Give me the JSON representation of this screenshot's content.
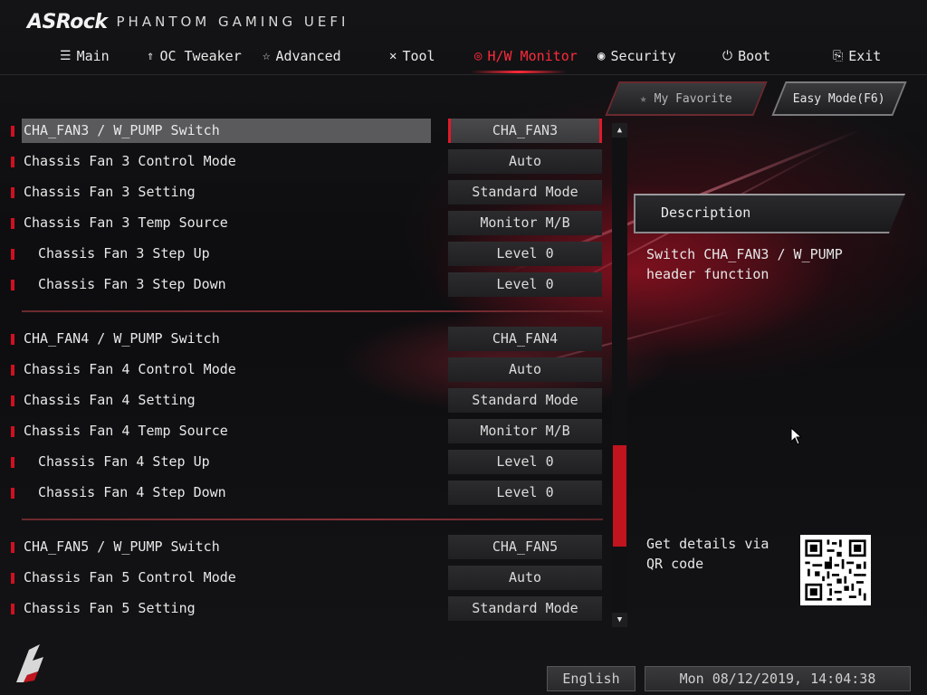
{
  "brand": {
    "logo": "ASRock",
    "subtitle": "PHANTOM GAMING UEFI"
  },
  "nav": [
    {
      "label": "Main",
      "icon": "list-icon"
    },
    {
      "label": "OC Tweaker",
      "icon": "rocket-icon"
    },
    {
      "label": "Advanced",
      "icon": "star-icon"
    },
    {
      "label": "Tool",
      "icon": "tools-icon"
    },
    {
      "label": "H/W Monitor",
      "icon": "monitor-icon",
      "active": true
    },
    {
      "label": "Security",
      "icon": "shield-icon"
    },
    {
      "label": "Boot",
      "icon": "power-icon"
    },
    {
      "label": "Exit",
      "icon": "exit-icon"
    }
  ],
  "buttons": {
    "favorite": "My Favorite",
    "easy_mode": "Easy Mode(F6)"
  },
  "settings": [
    {
      "label": "CHA_FAN3 / W_PUMP Switch",
      "value": "CHA_FAN3",
      "selected": true,
      "indent": false
    },
    {
      "label": "Chassis Fan 3 Control Mode",
      "value": "Auto",
      "indent": false
    },
    {
      "label": "Chassis Fan 3 Setting",
      "value": "Standard Mode",
      "indent": false
    },
    {
      "label": "Chassis Fan 3 Temp Source",
      "value": "Monitor M/B",
      "indent": false
    },
    {
      "label": "Chassis Fan 3 Step Up",
      "value": "Level 0",
      "indent": true
    },
    {
      "label": "Chassis Fan 3 Step Down",
      "value": "Level 0",
      "indent": true
    },
    {
      "label": "CHA_FAN4 / W_PUMP Switch",
      "value": "CHA_FAN4",
      "indent": false
    },
    {
      "label": "Chassis Fan 4 Control Mode",
      "value": "Auto",
      "indent": false
    },
    {
      "label": "Chassis Fan 4 Setting",
      "value": "Standard Mode",
      "indent": false
    },
    {
      "label": "Chassis Fan 4 Temp Source",
      "value": "Monitor M/B",
      "indent": false
    },
    {
      "label": "Chassis Fan 4 Step Up",
      "value": "Level 0",
      "indent": true
    },
    {
      "label": "Chassis Fan 4 Step Down",
      "value": "Level 0",
      "indent": true
    },
    {
      "label": "CHA_FAN5 / W_PUMP Switch",
      "value": "CHA_FAN5",
      "indent": false
    },
    {
      "label": "Chassis Fan 5 Control Mode",
      "value": "Auto",
      "indent": false
    },
    {
      "label": "Chassis Fan 5 Setting",
      "value": "Standard Mode",
      "indent": false
    }
  ],
  "description": {
    "title": "Description",
    "text": "Switch CHA_FAN3 / W_PUMP header function",
    "qr_text": "Get details via QR code"
  },
  "footer": {
    "language": "English",
    "datetime": "Mon 08/12/2019, 14:04:38"
  },
  "colors": {
    "accent": "#ff2a3a",
    "marker": "#d01020"
  }
}
